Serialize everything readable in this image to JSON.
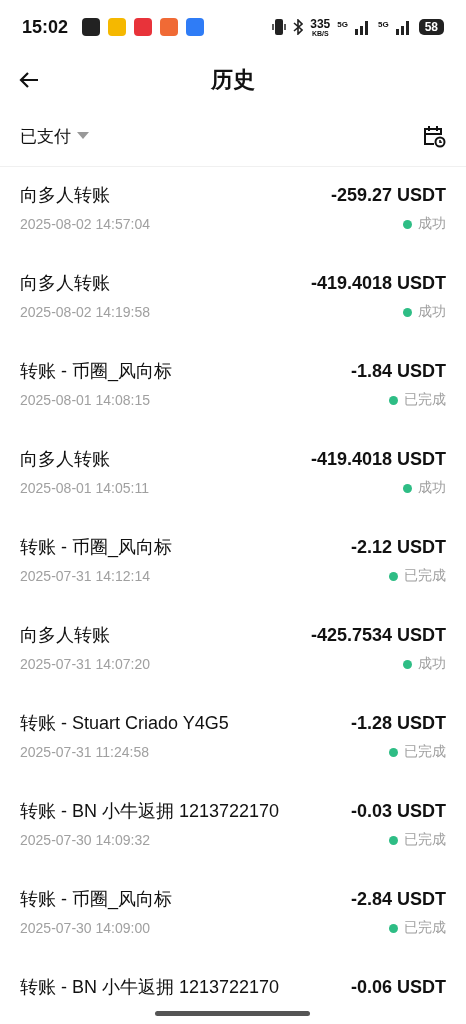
{
  "status_bar": {
    "time": "15:02",
    "speed": "335",
    "speed_unit": "KB/S",
    "network_1": "5G",
    "network_2": "5G",
    "battery": "58"
  },
  "header": {
    "title": "历史"
  },
  "filter": {
    "label": "已支付"
  },
  "transactions": [
    {
      "title": "向多人转账",
      "amount": "-259.27 USDT",
      "date": "2025-08-02 14:57:04",
      "status": "成功"
    },
    {
      "title": "向多人转账",
      "amount": "-419.4018 USDT",
      "date": "2025-08-02 14:19:58",
      "status": "成功"
    },
    {
      "title": "转账 - 币圈_风向标",
      "amount": "-1.84 USDT",
      "date": "2025-08-01 14:08:15",
      "status": "已完成"
    },
    {
      "title": "向多人转账",
      "amount": "-419.4018 USDT",
      "date": "2025-08-01 14:05:11",
      "status": "成功"
    },
    {
      "title": "转账 - 币圈_风向标",
      "amount": "-2.12 USDT",
      "date": "2025-07-31 14:12:14",
      "status": "已完成"
    },
    {
      "title": "向多人转账",
      "amount": "-425.7534 USDT",
      "date": "2025-07-31 14:07:20",
      "status": "成功"
    },
    {
      "title": "转账 - Stuart Criado Y4G5",
      "amount": "-1.28 USDT",
      "date": "2025-07-31 11:24:58",
      "status": "已完成"
    },
    {
      "title": "转账 - BN 小牛返拥 1213722170",
      "amount": "-0.03 USDT",
      "date": "2025-07-30 14:09:32",
      "status": "已完成"
    },
    {
      "title": "转账 - 币圈_风向标",
      "amount": "-2.84 USDT",
      "date": "2025-07-30 14:09:00",
      "status": "已完成"
    },
    {
      "title": "转账 - BN 小牛返拥 1213722170",
      "amount": "-0.06 USDT"
    }
  ]
}
